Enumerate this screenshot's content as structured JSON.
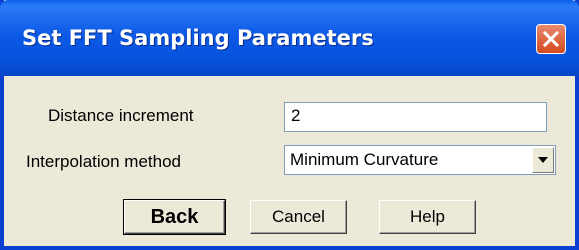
{
  "window": {
    "title": "Set FFT Sampling Parameters"
  },
  "form": {
    "distance_label": "Distance increment",
    "distance_value": "2",
    "interp_label": "Interpolation method",
    "interp_value": "Minimum Curvature"
  },
  "buttons": {
    "back": "Back",
    "cancel": "Cancel",
    "help": "Help"
  },
  "colors": {
    "titlebar": "#0a5ee8",
    "close": "#d44b1e",
    "face": "#ece9d8"
  },
  "icons": [
    "close-icon",
    "dropdown-arrow-icon"
  ]
}
